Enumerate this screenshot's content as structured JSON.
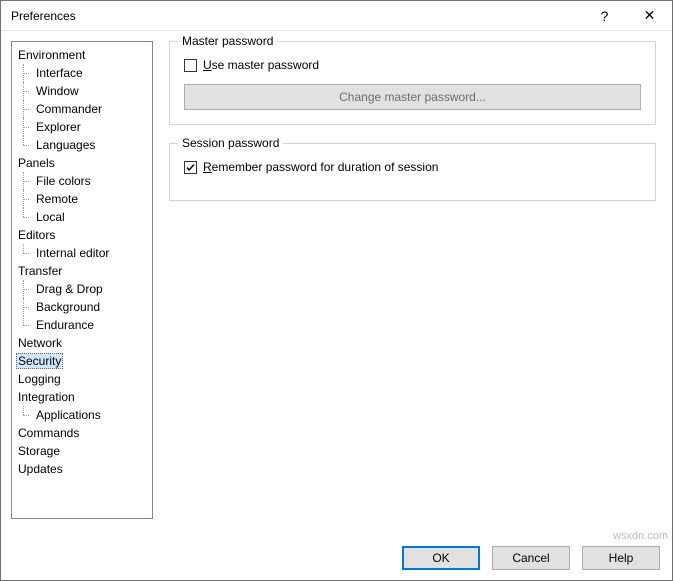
{
  "window": {
    "title": "Preferences",
    "help_glyph": "?",
    "close_glyph": "✕"
  },
  "tree": [
    {
      "label": "Environment",
      "children": [
        "Interface",
        "Window",
        "Commander",
        "Explorer",
        "Languages"
      ]
    },
    {
      "label": "Panels",
      "children": [
        "File colors",
        "Remote",
        "Local"
      ]
    },
    {
      "label": "Editors",
      "children": [
        "Internal editor"
      ]
    },
    {
      "label": "Transfer",
      "children": [
        "Drag & Drop",
        "Background",
        "Endurance"
      ]
    },
    {
      "label": "Network"
    },
    {
      "label": "Security",
      "selected": true
    },
    {
      "label": "Logging"
    },
    {
      "label": "Integration",
      "children": [
        "Applications"
      ]
    },
    {
      "label": "Commands"
    },
    {
      "label": "Storage"
    },
    {
      "label": "Updates"
    }
  ],
  "groups": {
    "master": {
      "title": "Master password",
      "use_label_pre": "U",
      "use_label_post": "se master password",
      "use_checked": false,
      "change_btn": "Change master password..."
    },
    "session": {
      "title": "Session password",
      "remember_label_pre": "R",
      "remember_label_post": "emember password for duration of session",
      "remember_checked": true
    }
  },
  "footer": {
    "ok": "OK",
    "cancel": "Cancel",
    "help": "Help"
  },
  "watermark": "wsxdn.com"
}
